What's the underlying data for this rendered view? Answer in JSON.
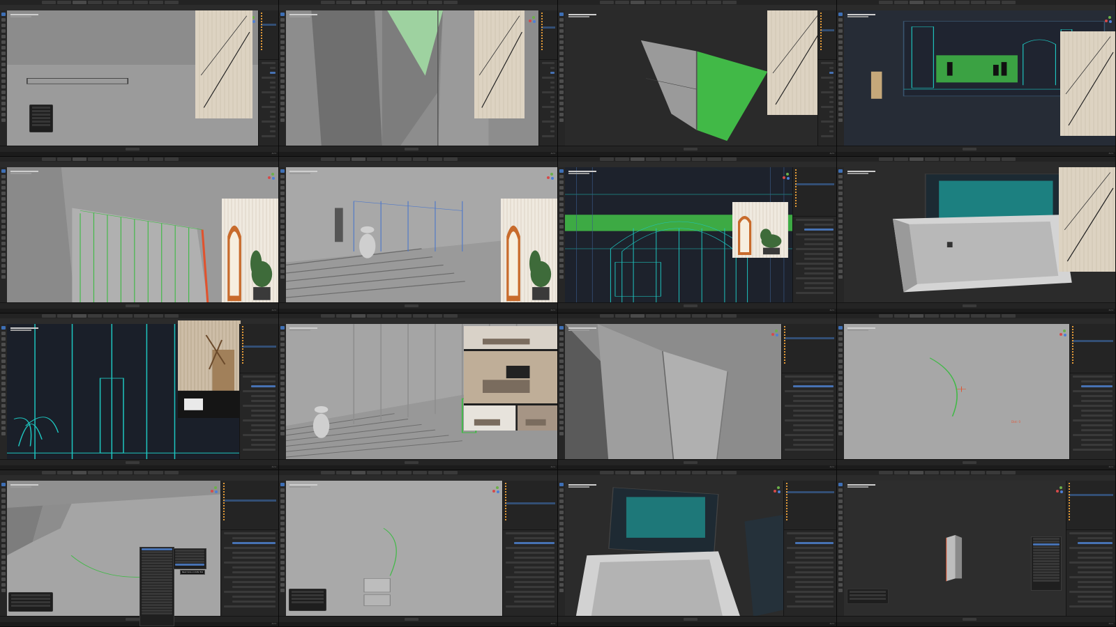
{
  "app": "Blender",
  "layout": "4x4 contact sheet of Blender screenshots",
  "colors": {
    "ui_dark": "#1d1d1d",
    "panel": "#262626",
    "viewport_grey": "#7a7a7a",
    "wood": "#ddd3c2",
    "green": "#41b947",
    "teal": "#1ec6c0",
    "blue_select": "#4772b3",
    "orange": "#e49b38"
  },
  "icons": [
    "move-tool-icon",
    "rotate-tool-icon",
    "scale-tool-icon",
    "navigation-gizmo-icon",
    "camera-icon",
    "light-icon",
    "mesh-icon",
    "play-icon"
  ],
  "tiles": [
    {
      "id": 1,
      "scene": "grey floor with wire outline of a bench",
      "reference": "light wood slat wall panel",
      "panel": "operator-redo"
    },
    {
      "id": 2,
      "scene": "wall corner with green translucent glass panel",
      "reference": "light wood slat wall panel"
    },
    {
      "id": 3,
      "scene": "folding grey door with green selected face on dark background",
      "reference": "light wood slat wall panel"
    },
    {
      "id": 4,
      "scene": "orthographic elevation with green wall section and human silhouettes",
      "reference": "light wood panel"
    },
    {
      "id": 5,
      "scene": "grey wall with green railing outline and orange edge",
      "reference": "wood slat interior with arch mirror and plant"
    },
    {
      "id": 6,
      "scene": "mannequin on staircase with blue panel outlines",
      "reference": "wood slat interior with arch mirror"
    },
    {
      "id": 7,
      "scene": "orthographic elevation with arch window and green band",
      "reference": "arch mirror alcove with plant"
    },
    {
      "id": 8,
      "scene": "top view of room shell with teal elevation wall",
      "reference": "wood slat corner shelf"
    },
    {
      "id": 9,
      "scene": "teal line elevation with palm drawing",
      "reference": "interior shelf and low table photo"
    },
    {
      "id": 10,
      "scene": "mannequin on stairs beside tall wall panels",
      "reference": "stack of living room photos"
    },
    {
      "id": 11,
      "scene": "close-up of grey wall panels at angle"
    },
    {
      "id": 12,
      "scene": "grey ground with green arc curve",
      "readout": "Dist: 0"
    },
    {
      "id": 13,
      "scene": "grey panels with green arc and add menu open",
      "tooltip": "Read more on Knife Tool"
    },
    {
      "id": 14,
      "scene": "grey ground with green arc and small box"
    },
    {
      "id": 15,
      "scene": "room shell perspective with teal elevation wall"
    },
    {
      "id": 16,
      "scene": "dark viewport with single grey pillar and add menu"
    }
  ],
  "status": {
    "version": "4.2.1"
  }
}
